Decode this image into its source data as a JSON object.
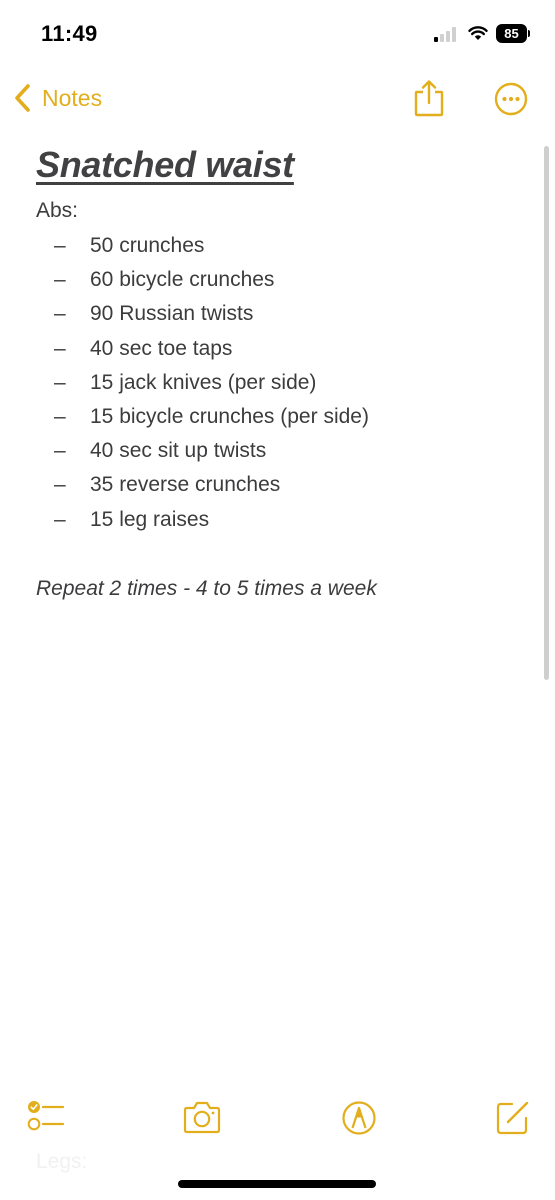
{
  "status_bar": {
    "time": "11:49",
    "battery_level": "85",
    "signal_bars_active": 1,
    "signal_bars_total": 4
  },
  "nav": {
    "back_label": "Notes",
    "back_icon": "chevron-left-icon",
    "share_icon": "share-icon",
    "more_icon": "ellipsis-circle-icon"
  },
  "note": {
    "title": "Snatched waist",
    "section": "Abs:",
    "items": [
      "50 crunches",
      "60 bicycle crunches",
      "90 Russian twists",
      "40 sec toe taps",
      "15 jack knives (per side)",
      "15 bicycle crunches (per side)",
      "40 sec sit up twists",
      "35 reverse crunches",
      "15 leg raises"
    ],
    "bullet": "–",
    "footer": "Repeat 2 times - 4 to 5 times a week",
    "faded_section": "Legs:"
  },
  "toolbar": {
    "checklist_icon": "checklist-icon",
    "camera_icon": "camera-icon",
    "markup_icon": "markup-pen-icon",
    "compose_icon": "compose-icon"
  },
  "colors": {
    "accent": "#e3ae1c",
    "text": "#3c3c3e",
    "background": "#ffffff"
  }
}
